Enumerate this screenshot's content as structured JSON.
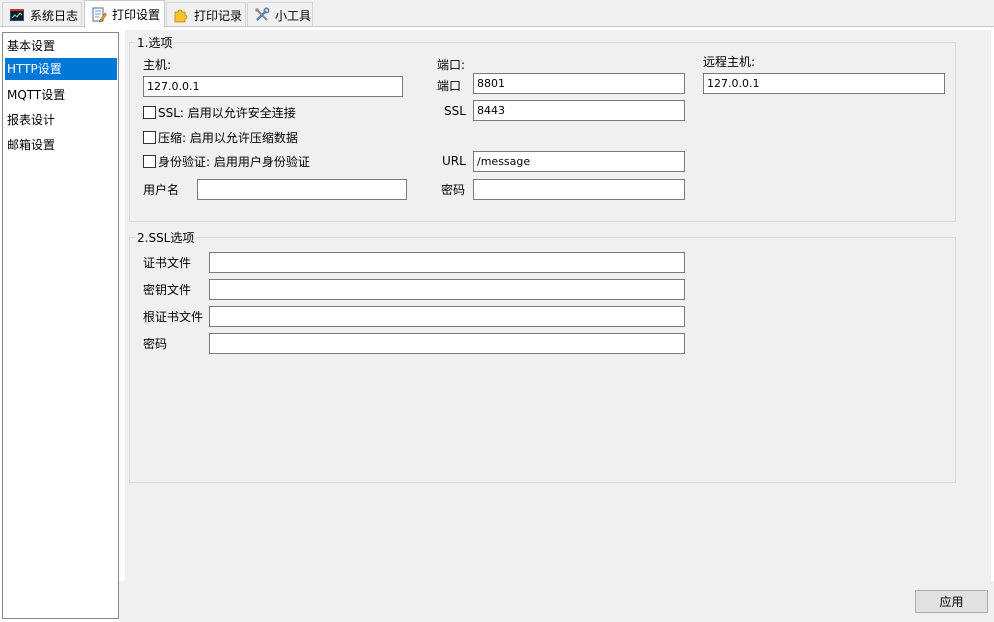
{
  "tabs": [
    {
      "label": "系统日志",
      "icon": "chart-window-icon"
    },
    {
      "label": "打印设置",
      "icon": "edit-document-icon",
      "active": true
    },
    {
      "label": "打印记录",
      "icon": "puzzle-icon"
    },
    {
      "label": "小工具",
      "icon": "tools-icon"
    }
  ],
  "nav": {
    "items": [
      "基本设置",
      "HTTP设置",
      "MQTT设置",
      "报表设计",
      "邮箱设置"
    ],
    "selected": 1
  },
  "options": {
    "title": "1.选项",
    "host_label": "主机:",
    "host_value": "127.0.0.1",
    "ssl_check": "SSL: 启用以允许安全连接",
    "compress_check": "压缩: 启用以允许压缩数据",
    "auth_check": "身份验证: 启用用户身份验证",
    "username_label": "用户名",
    "username_value": "",
    "port_header": "端口:",
    "port_label": "端口",
    "port_value": "8801",
    "ssl_label": "SSL",
    "ssl_value": "8443",
    "url_label": "URL",
    "url_value": "/message",
    "password_label": "密码",
    "password_value": "",
    "remote_host_label": "远程主机:",
    "remote_host_value": "127.0.0.1"
  },
  "ssl_options": {
    "title": "2.SSL选项",
    "cert_label": "证书文件",
    "cert_value": "",
    "key_label": "密钥文件",
    "key_value": "",
    "root_cert_label": "根证书文件",
    "root_cert_value": "",
    "password_label": "密码",
    "password_value": ""
  },
  "apply_label": "应用"
}
